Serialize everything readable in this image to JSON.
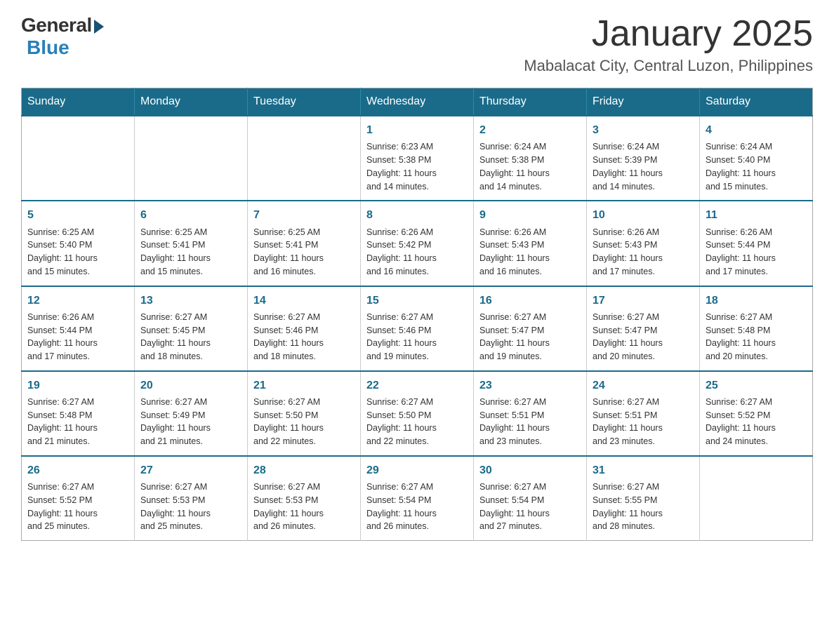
{
  "logo": {
    "general": "General",
    "blue": "Blue"
  },
  "title": "January 2025",
  "location": "Mabalacat City, Central Luzon, Philippines",
  "days_of_week": [
    "Sunday",
    "Monday",
    "Tuesday",
    "Wednesday",
    "Thursday",
    "Friday",
    "Saturday"
  ],
  "weeks": [
    [
      {
        "day": "",
        "info": ""
      },
      {
        "day": "",
        "info": ""
      },
      {
        "day": "",
        "info": ""
      },
      {
        "day": "1",
        "info": "Sunrise: 6:23 AM\nSunset: 5:38 PM\nDaylight: 11 hours\nand 14 minutes."
      },
      {
        "day": "2",
        "info": "Sunrise: 6:24 AM\nSunset: 5:38 PM\nDaylight: 11 hours\nand 14 minutes."
      },
      {
        "day": "3",
        "info": "Sunrise: 6:24 AM\nSunset: 5:39 PM\nDaylight: 11 hours\nand 14 minutes."
      },
      {
        "day": "4",
        "info": "Sunrise: 6:24 AM\nSunset: 5:40 PM\nDaylight: 11 hours\nand 15 minutes."
      }
    ],
    [
      {
        "day": "5",
        "info": "Sunrise: 6:25 AM\nSunset: 5:40 PM\nDaylight: 11 hours\nand 15 minutes."
      },
      {
        "day": "6",
        "info": "Sunrise: 6:25 AM\nSunset: 5:41 PM\nDaylight: 11 hours\nand 15 minutes."
      },
      {
        "day": "7",
        "info": "Sunrise: 6:25 AM\nSunset: 5:41 PM\nDaylight: 11 hours\nand 16 minutes."
      },
      {
        "day": "8",
        "info": "Sunrise: 6:26 AM\nSunset: 5:42 PM\nDaylight: 11 hours\nand 16 minutes."
      },
      {
        "day": "9",
        "info": "Sunrise: 6:26 AM\nSunset: 5:43 PM\nDaylight: 11 hours\nand 16 minutes."
      },
      {
        "day": "10",
        "info": "Sunrise: 6:26 AM\nSunset: 5:43 PM\nDaylight: 11 hours\nand 17 minutes."
      },
      {
        "day": "11",
        "info": "Sunrise: 6:26 AM\nSunset: 5:44 PM\nDaylight: 11 hours\nand 17 minutes."
      }
    ],
    [
      {
        "day": "12",
        "info": "Sunrise: 6:26 AM\nSunset: 5:44 PM\nDaylight: 11 hours\nand 17 minutes."
      },
      {
        "day": "13",
        "info": "Sunrise: 6:27 AM\nSunset: 5:45 PM\nDaylight: 11 hours\nand 18 minutes."
      },
      {
        "day": "14",
        "info": "Sunrise: 6:27 AM\nSunset: 5:46 PM\nDaylight: 11 hours\nand 18 minutes."
      },
      {
        "day": "15",
        "info": "Sunrise: 6:27 AM\nSunset: 5:46 PM\nDaylight: 11 hours\nand 19 minutes."
      },
      {
        "day": "16",
        "info": "Sunrise: 6:27 AM\nSunset: 5:47 PM\nDaylight: 11 hours\nand 19 minutes."
      },
      {
        "day": "17",
        "info": "Sunrise: 6:27 AM\nSunset: 5:47 PM\nDaylight: 11 hours\nand 20 minutes."
      },
      {
        "day": "18",
        "info": "Sunrise: 6:27 AM\nSunset: 5:48 PM\nDaylight: 11 hours\nand 20 minutes."
      }
    ],
    [
      {
        "day": "19",
        "info": "Sunrise: 6:27 AM\nSunset: 5:48 PM\nDaylight: 11 hours\nand 21 minutes."
      },
      {
        "day": "20",
        "info": "Sunrise: 6:27 AM\nSunset: 5:49 PM\nDaylight: 11 hours\nand 21 minutes."
      },
      {
        "day": "21",
        "info": "Sunrise: 6:27 AM\nSunset: 5:50 PM\nDaylight: 11 hours\nand 22 minutes."
      },
      {
        "day": "22",
        "info": "Sunrise: 6:27 AM\nSunset: 5:50 PM\nDaylight: 11 hours\nand 22 minutes."
      },
      {
        "day": "23",
        "info": "Sunrise: 6:27 AM\nSunset: 5:51 PM\nDaylight: 11 hours\nand 23 minutes."
      },
      {
        "day": "24",
        "info": "Sunrise: 6:27 AM\nSunset: 5:51 PM\nDaylight: 11 hours\nand 23 minutes."
      },
      {
        "day": "25",
        "info": "Sunrise: 6:27 AM\nSunset: 5:52 PM\nDaylight: 11 hours\nand 24 minutes."
      }
    ],
    [
      {
        "day": "26",
        "info": "Sunrise: 6:27 AM\nSunset: 5:52 PM\nDaylight: 11 hours\nand 25 minutes."
      },
      {
        "day": "27",
        "info": "Sunrise: 6:27 AM\nSunset: 5:53 PM\nDaylight: 11 hours\nand 25 minutes."
      },
      {
        "day": "28",
        "info": "Sunrise: 6:27 AM\nSunset: 5:53 PM\nDaylight: 11 hours\nand 26 minutes."
      },
      {
        "day": "29",
        "info": "Sunrise: 6:27 AM\nSunset: 5:54 PM\nDaylight: 11 hours\nand 26 minutes."
      },
      {
        "day": "30",
        "info": "Sunrise: 6:27 AM\nSunset: 5:54 PM\nDaylight: 11 hours\nand 27 minutes."
      },
      {
        "day": "31",
        "info": "Sunrise: 6:27 AM\nSunset: 5:55 PM\nDaylight: 11 hours\nand 28 minutes."
      },
      {
        "day": "",
        "info": ""
      }
    ]
  ]
}
